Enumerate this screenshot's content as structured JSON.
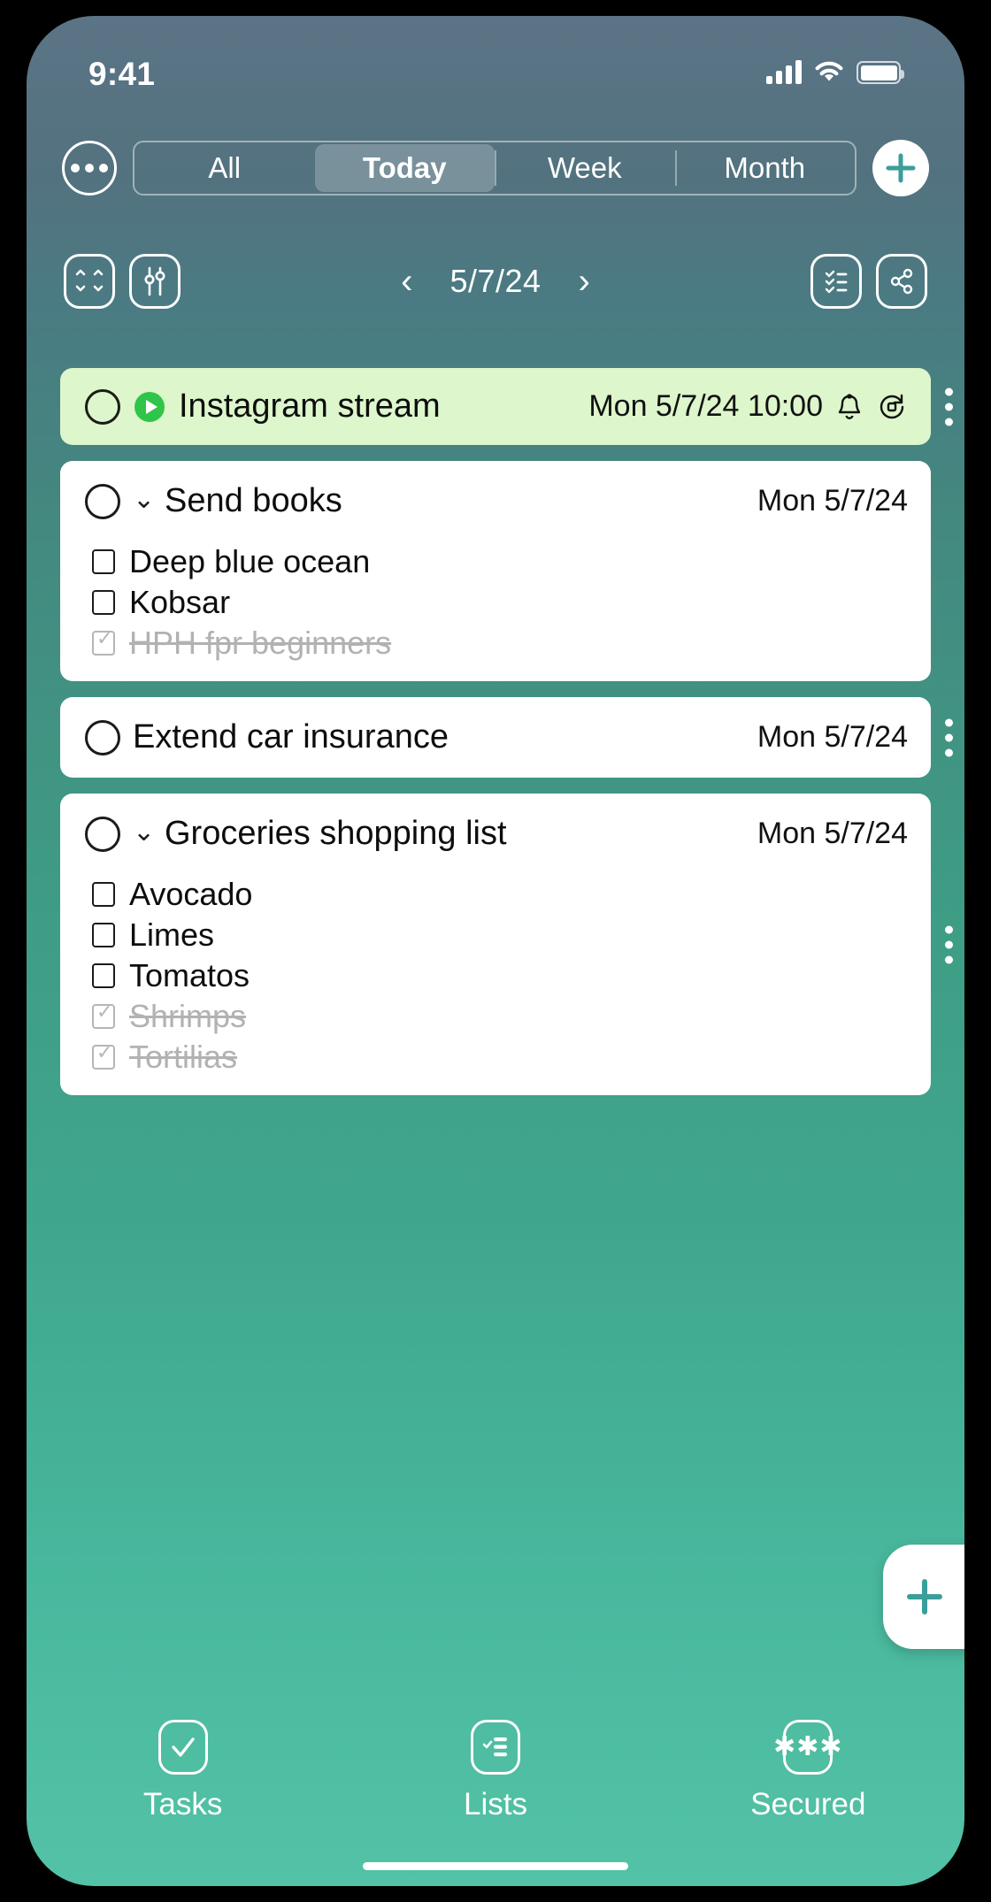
{
  "status_bar": {
    "time": "9:41",
    "icons": [
      "cellular-signal-icon",
      "wifi-icon",
      "battery-icon"
    ]
  },
  "toolbar": {
    "more_icon": "ellipsis-icon",
    "segments": [
      {
        "label": "All",
        "active": false
      },
      {
        "label": "Today",
        "active": true
      },
      {
        "label": "Week",
        "active": false
      },
      {
        "label": "Month",
        "active": false
      }
    ],
    "add_icon": "plus-icon"
  },
  "date_bar": {
    "collapse_icon": "expand-collapse-icon",
    "filter_icon": "sliders-filter-icon",
    "prev_icon": "chevron-left-icon",
    "date": "5/7/24",
    "next_icon": "chevron-right-icon",
    "checklist_icon": "checklist-icon",
    "share_icon": "share-icon"
  },
  "tasks": [
    {
      "title": "Instagram stream",
      "meta": "Mon 5/7/24 10:00",
      "highlight": true,
      "has_play": true,
      "has_caret": false,
      "badges": [
        "bell-icon",
        "recurring-icon"
      ],
      "subtasks": []
    },
    {
      "title": "Send books",
      "meta": "Mon 5/7/24",
      "highlight": false,
      "has_play": false,
      "has_caret": true,
      "badges": [],
      "subtasks": [
        {
          "text": "Deep blue ocean",
          "done": false
        },
        {
          "text": "Kobsar",
          "done": false
        },
        {
          "text": "HPH fpr beginners",
          "done": true
        }
      ]
    },
    {
      "title": "Extend car insurance",
      "meta": "Mon 5/7/24",
      "highlight": false,
      "has_play": false,
      "has_caret": false,
      "badges": [],
      "subtasks": []
    },
    {
      "title": "Groceries shopping list",
      "meta": "Mon 5/7/24",
      "highlight": false,
      "has_play": false,
      "has_caret": true,
      "badges": [],
      "subtasks": [
        {
          "text": "Avocado",
          "done": false
        },
        {
          "text": "Limes",
          "done": false
        },
        {
          "text": "Tomatos",
          "done": false
        },
        {
          "text": "Shrimps",
          "done": true
        },
        {
          "text": "Tortilias",
          "done": true
        }
      ]
    }
  ],
  "fab": {
    "icon": "plus-icon"
  },
  "tab_bar": [
    {
      "label": "Tasks",
      "icon": "checkmark-box-icon",
      "active": true
    },
    {
      "label": "Lists",
      "icon": "checklist-box-icon",
      "active": false
    },
    {
      "label": "Secured",
      "icon": "password-asterisks-icon",
      "active": false
    }
  ],
  "colors": {
    "bg_top": "#5b7486",
    "bg_bottom": "#53c2a6",
    "card": "#ffffff",
    "card_highlight": "#ddf6cb",
    "accent": "#3a9e9a",
    "play_green": "#2fc54a",
    "done_text": "#b2b2b2"
  }
}
